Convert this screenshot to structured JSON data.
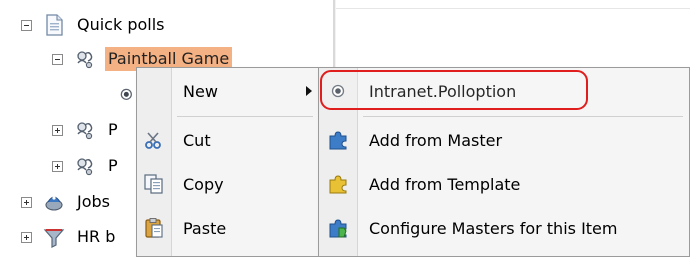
{
  "tree": {
    "items": [
      {
        "label": "Quick polls",
        "icon": "document-icon",
        "expander": "minus"
      },
      {
        "label": "Paintball Game",
        "icon": "poll-icon",
        "expander": "minus",
        "selected": true
      },
      {
        "label": "",
        "icon": "radio-icon",
        "expander": "none"
      },
      {
        "label": "P",
        "icon": "poll-icon",
        "expander": "plus"
      },
      {
        "label": "P",
        "icon": "poll-icon",
        "expander": "plus"
      },
      {
        "label": "Jobs",
        "icon": "jobs-icon",
        "expander": "plus"
      },
      {
        "label": "HR b",
        "icon": "funnel-icon",
        "expander": "plus"
      }
    ]
  },
  "context_menu": {
    "items": [
      {
        "label": "New",
        "icon": "none",
        "has_submenu": true
      },
      {
        "label": "Cut",
        "icon": "scissors-icon"
      },
      {
        "label": "Copy",
        "icon": "copy-icon"
      },
      {
        "label": "Paste",
        "icon": "paste-icon"
      }
    ]
  },
  "submenu": {
    "items": [
      {
        "label": "Intranet.Polloption",
        "icon": "radio-icon",
        "highlighted": true
      },
      {
        "label": "Add from Master",
        "icon": "puzzle-blue-icon"
      },
      {
        "label": "Add from Template",
        "icon": "puzzle-yellow-icon"
      },
      {
        "label": "Configure Masters for this Item",
        "icon": "puzzle-green-icon"
      }
    ]
  },
  "colors": {
    "selection": "#f4b183",
    "highlight_border": "#e01e1e",
    "menu_bg": "#f5f5f5"
  }
}
